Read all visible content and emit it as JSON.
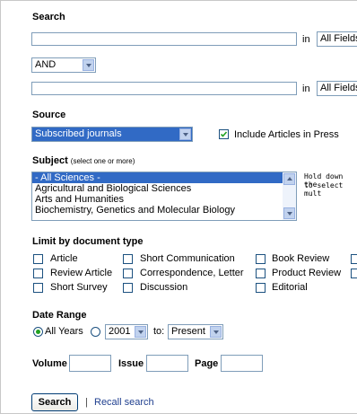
{
  "search": {
    "heading": "Search",
    "in_label_1": "in",
    "field_1": "All Fields",
    "operator": "AND",
    "in_label_2": "in",
    "field_2": "All Fields",
    "term_1": "",
    "term_2": ""
  },
  "source": {
    "heading": "Source",
    "selected": "Subscribed journals",
    "include_label": "Include Articles in Press",
    "include_checked": true
  },
  "subject": {
    "heading": "Subject",
    "note": "(select one or more)",
    "items": [
      "- All Sciences -",
      "Agricultural and Biological Sciences",
      "Arts and Humanities",
      "Biochemistry, Genetics and Molecular Biology"
    ],
    "hint_line1": "Hold down the",
    "hint_line2": "to select mult"
  },
  "doctype": {
    "heading": "Limit by document type",
    "col1": [
      "Article",
      "Review Article",
      "Short Survey"
    ],
    "col2": [
      "Short Communication",
      "Correspondence, Letter",
      "Discussion"
    ],
    "col3": [
      "Book Review",
      "Product Review",
      "Editorial"
    ]
  },
  "date": {
    "heading": "Date Range",
    "all_years": "All Years",
    "from_year": "2001",
    "to_label": "to:",
    "to_value": "Present"
  },
  "volume": {
    "volume_label": "Volume",
    "issue_label": "Issue",
    "page_label": "Page"
  },
  "actions": {
    "search_button": "Search",
    "separator": "|",
    "recall_link": "Recall search"
  }
}
